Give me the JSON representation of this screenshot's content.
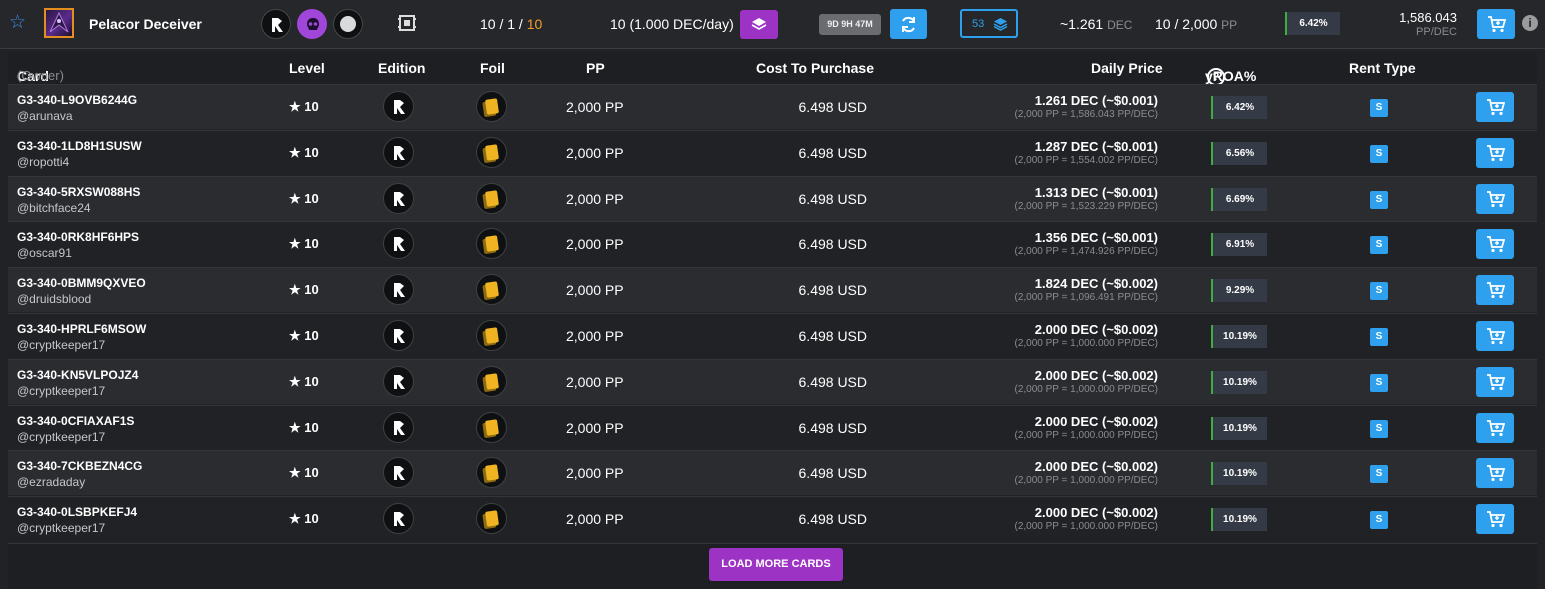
{
  "topbar": {
    "card_name": "Pelacor Deceiver",
    "levels_a": "10 / 1 / ",
    "levels_b": "10",
    "dec_per_day": "10 (1.000 DEC/day)",
    "timer": "9D 9H 47M",
    "stack_count": "53",
    "price_value": "~1.261",
    "price_unit": "DEC",
    "pp_value": "10 / 2,000",
    "pp_unit": "PP",
    "roa": "6.42%",
    "pp_per_dec_value": "1,586.043",
    "pp_per_dec_unit": "PP/DEC",
    "info_label": "i"
  },
  "table": {
    "headers": {
      "card": "Card",
      "owner": "(Owner)",
      "level": "Level",
      "edition": "Edition",
      "foil": "Foil",
      "pp": "PP",
      "cost": "Cost To Purchase",
      "daily": "Daily Price",
      "yroa": "yROA%",
      "help": "?",
      "rent_type": "Rent Type"
    },
    "rows": [
      {
        "uid": "G3-340-L9OVB6244G",
        "owner": "@arunava",
        "level": "10",
        "pp": "2,000 PP",
        "cost": "6.498 USD",
        "daily": "1.261 DEC (~$0.001)",
        "daily_sub": "(2,000 PP = 1,586.043 PP/DEC)",
        "roa": "6.42%",
        "rent": "S"
      },
      {
        "uid": "G3-340-1LD8H1SUSW",
        "owner": "@ropotti4",
        "level": "10",
        "pp": "2,000 PP",
        "cost": "6.498 USD",
        "daily": "1.287 DEC (~$0.001)",
        "daily_sub": "(2,000 PP = 1,554.002 PP/DEC)",
        "roa": "6.56%",
        "rent": "S"
      },
      {
        "uid": "G3-340-5RXSW088HS",
        "owner": "@bitchface24",
        "level": "10",
        "pp": "2,000 PP",
        "cost": "6.498 USD",
        "daily": "1.313 DEC (~$0.001)",
        "daily_sub": "(2,000 PP = 1,523.229 PP/DEC)",
        "roa": "6.69%",
        "rent": "S"
      },
      {
        "uid": "G3-340-0RK8HF6HPS",
        "owner": "@oscar91",
        "level": "10",
        "pp": "2,000 PP",
        "cost": "6.498 USD",
        "daily": "1.356 DEC (~$0.001)",
        "daily_sub": "(2,000 PP = 1,474.926 PP/DEC)",
        "roa": "6.91%",
        "rent": "S"
      },
      {
        "uid": "G3-340-0BMM9QXVEO",
        "owner": "@druidsblood",
        "level": "10",
        "pp": "2,000 PP",
        "cost": "6.498 USD",
        "daily": "1.824 DEC (~$0.002)",
        "daily_sub": "(2,000 PP = 1,096.491 PP/DEC)",
        "roa": "9.29%",
        "rent": "S"
      },
      {
        "uid": "G3-340-HPRLF6MSOW",
        "owner": "@cryptkeeper17",
        "level": "10",
        "pp": "2,000 PP",
        "cost": "6.498 USD",
        "daily": "2.000 DEC (~$0.002)",
        "daily_sub": "(2,000 PP = 1,000.000 PP/DEC)",
        "roa": "10.19%",
        "rent": "S"
      },
      {
        "uid": "G3-340-KN5VLPOJZ4",
        "owner": "@cryptkeeper17",
        "level": "10",
        "pp": "2,000 PP",
        "cost": "6.498 USD",
        "daily": "2.000 DEC (~$0.002)",
        "daily_sub": "(2,000 PP = 1,000.000 PP/DEC)",
        "roa": "10.19%",
        "rent": "S"
      },
      {
        "uid": "G3-340-0CFIAXAF1S",
        "owner": "@cryptkeeper17",
        "level": "10",
        "pp": "2,000 PP",
        "cost": "6.498 USD",
        "daily": "2.000 DEC (~$0.002)",
        "daily_sub": "(2,000 PP = 1,000.000 PP/DEC)",
        "roa": "10.19%",
        "rent": "S"
      },
      {
        "uid": "G3-340-7CKBEZN4CG",
        "owner": "@ezradaday",
        "level": "10",
        "pp": "2,000 PP",
        "cost": "6.498 USD",
        "daily": "2.000 DEC (~$0.002)",
        "daily_sub": "(2,000 PP = 1,000.000 PP/DEC)",
        "roa": "10.19%",
        "rent": "S"
      },
      {
        "uid": "G3-340-0LSBPKEFJ4",
        "owner": "@cryptkeeper17",
        "level": "10",
        "pp": "2,000 PP",
        "cost": "6.498 USD",
        "daily": "2.000 DEC (~$0.002)",
        "daily_sub": "(2,000 PP = 1,000.000 PP/DEC)",
        "roa": "10.19%",
        "rent": "S"
      }
    ]
  },
  "footer": {
    "load_more": "LOAD MORE CARDS"
  },
  "colors": {
    "accent_blue": "#2ea0ee",
    "accent_purple": "#9d33c4",
    "highlight_orange": "#f29b2a",
    "roa_green": "#3fae3f"
  },
  "icons": [
    "star-outline-icon",
    "edition-r-icon",
    "skull-icon",
    "white-circle-icon",
    "card-frame-icon",
    "layers-icon",
    "refresh-icon",
    "cart-icon",
    "info-icon",
    "foil-cards-icon",
    "star-filled-icon",
    "help-icon"
  ]
}
